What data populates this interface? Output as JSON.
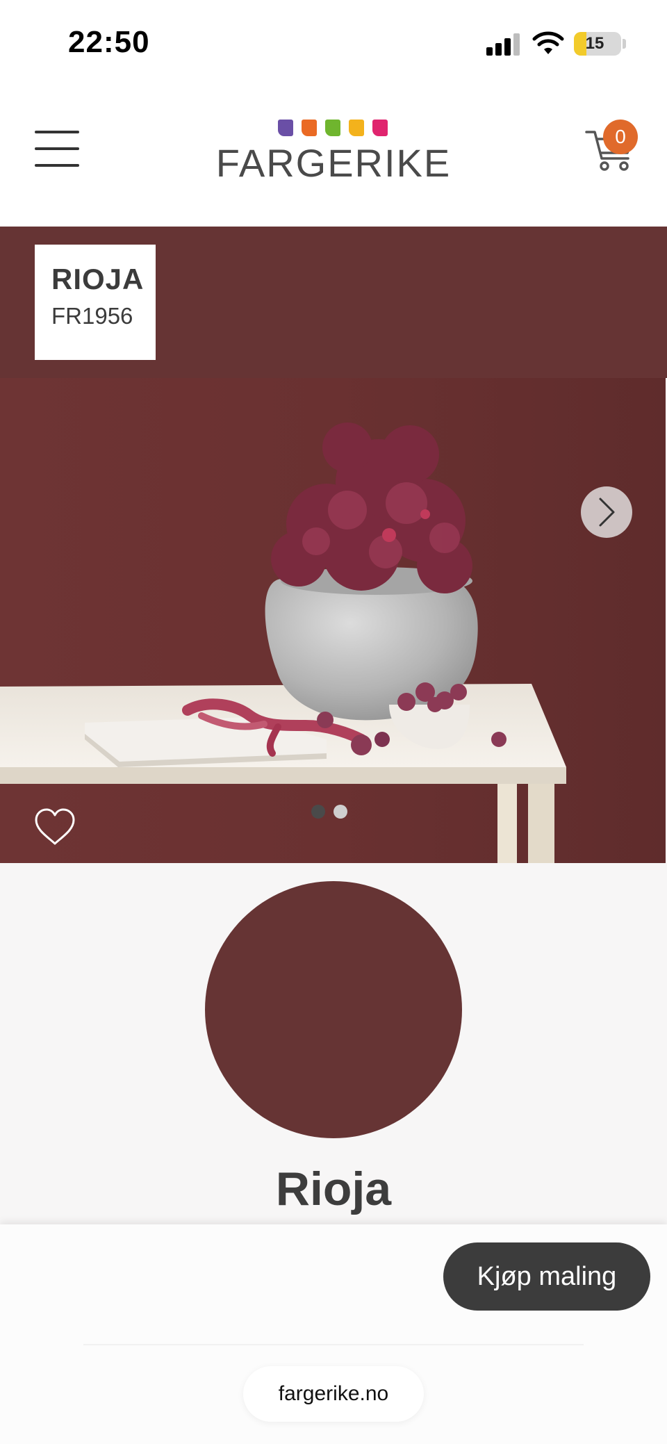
{
  "status_bar": {
    "time": "22:50",
    "battery": "15",
    "battery_level": 0.15
  },
  "header": {
    "logo_text": "FARGERIKE",
    "logo_colors": [
      "#6a4fa6",
      "#ea6a24",
      "#6fb52e",
      "#f3b21c",
      "#e0246e"
    ],
    "cart_count": "0",
    "icons": {
      "menu": "hamburger-menu-icon",
      "cart": "shopping-cart-icon"
    }
  },
  "product": {
    "name_caps": "RIOJA",
    "code": "FR1956",
    "name": "Rioja",
    "color": "#663434"
  },
  "carousel": {
    "total_slides": 2,
    "active_slide": 1,
    "icons": {
      "next": "chevron-right-icon",
      "favorite": "heart-icon"
    }
  },
  "actions": {
    "buy_label": "Kjøp maling"
  },
  "browser": {
    "url": "fargerike.no"
  },
  "colors": {
    "brand_dark": "#3c3c3c",
    "cart_badge": "#e06a2b",
    "battery": "#f2cb2b"
  }
}
